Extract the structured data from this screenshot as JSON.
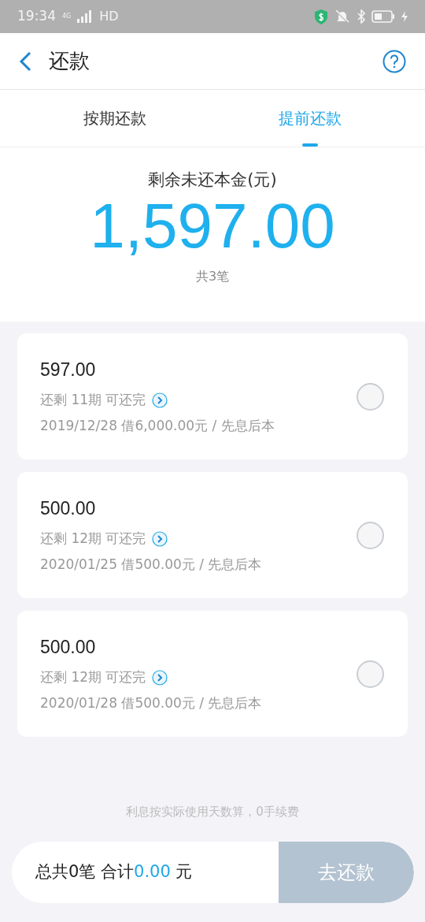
{
  "status_bar": {
    "time": "19:34",
    "network": "4G",
    "hd": "HD"
  },
  "header": {
    "title": "还款"
  },
  "tabs": [
    {
      "label": "按期还款",
      "selected": false
    },
    {
      "label": "提前还款",
      "selected": true
    }
  ],
  "summary": {
    "label": "剩余未还本金(元)",
    "amount": "1,597.00",
    "count": "共3笔"
  },
  "loans": [
    {
      "amount": "597.00",
      "remaining": "还剩 11期 可还完",
      "detail": "2019/12/28 借6,000.00元 / 先息后本",
      "selected": false
    },
    {
      "amount": "500.00",
      "remaining": "还剩 12期 可还完",
      "detail": "2020/01/25 借500.00元 / 先息后本",
      "selected": false
    },
    {
      "amount": "500.00",
      "remaining": "还剩 12期 可还完",
      "detail": "2020/01/28 借500.00元 / 先息后本",
      "selected": false
    }
  ],
  "note": "利息按实际使用天数算，0手续费",
  "footer": {
    "prefix": "总共0笔 合计",
    "total": "0.00",
    "unit": " 元",
    "button": "去还款",
    "disabled": true
  }
}
